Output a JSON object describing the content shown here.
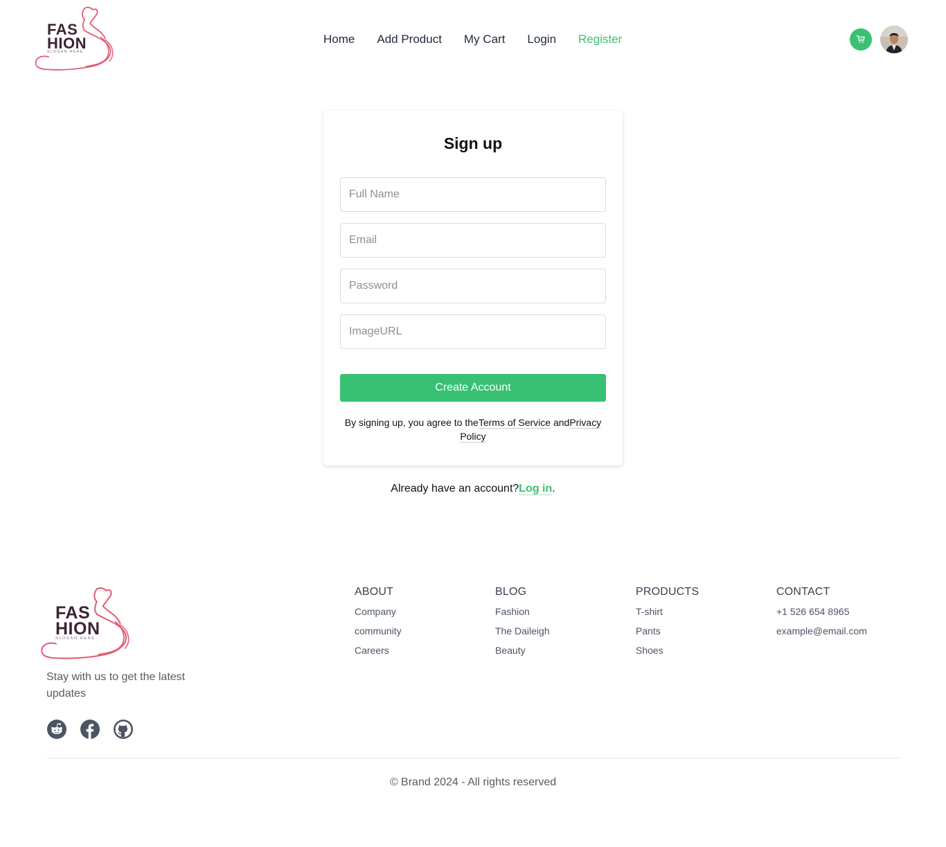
{
  "brand": {
    "logo_line1": "FAS",
    "logo_line2": "HION",
    "logo_slogan": "SLOGAN HERE"
  },
  "nav": {
    "items": [
      {
        "label": "Home",
        "active": false
      },
      {
        "label": "Add Product",
        "active": false
      },
      {
        "label": "My Cart",
        "active": false
      },
      {
        "label": "Login",
        "active": false
      },
      {
        "label": "Register",
        "active": true
      }
    ],
    "cart_icon": "cart-icon",
    "accent_color": "#38c172"
  },
  "form": {
    "title": "Sign up",
    "fields": [
      {
        "placeholder": "Full Name",
        "value": ""
      },
      {
        "placeholder": "Email",
        "value": ""
      },
      {
        "placeholder": "Password",
        "value": ""
      },
      {
        "placeholder": "ImageURL",
        "value": ""
      }
    ],
    "submit_label": "Create Account",
    "terms_prefix": "By signing up, you agree to the",
    "terms_link": "Terms of Service",
    "terms_and": " and",
    "privacy_link": "Privacy Policy"
  },
  "login_prompt": {
    "text": "Already have an account?",
    "link": "Log in",
    "suffix": "."
  },
  "footer": {
    "tagline": "Stay with us to get the latest updates",
    "socials": [
      "reddit-icon",
      "facebook-icon",
      "github-icon"
    ],
    "columns": [
      {
        "title": "ABOUT",
        "links": [
          "Company",
          "community",
          "Careers"
        ]
      },
      {
        "title": "BLOG",
        "links": [
          "Fashion",
          "The Daileigh",
          "Beauty"
        ]
      },
      {
        "title": "PRODUCTS",
        "links": [
          "T-shirt",
          "Pants",
          "Shoes"
        ]
      },
      {
        "title": "CONTACT",
        "links": [
          "+1 526 654 8965",
          "example@email.com"
        ]
      }
    ],
    "copyright": "© Brand 2024 - All rights reserved"
  }
}
